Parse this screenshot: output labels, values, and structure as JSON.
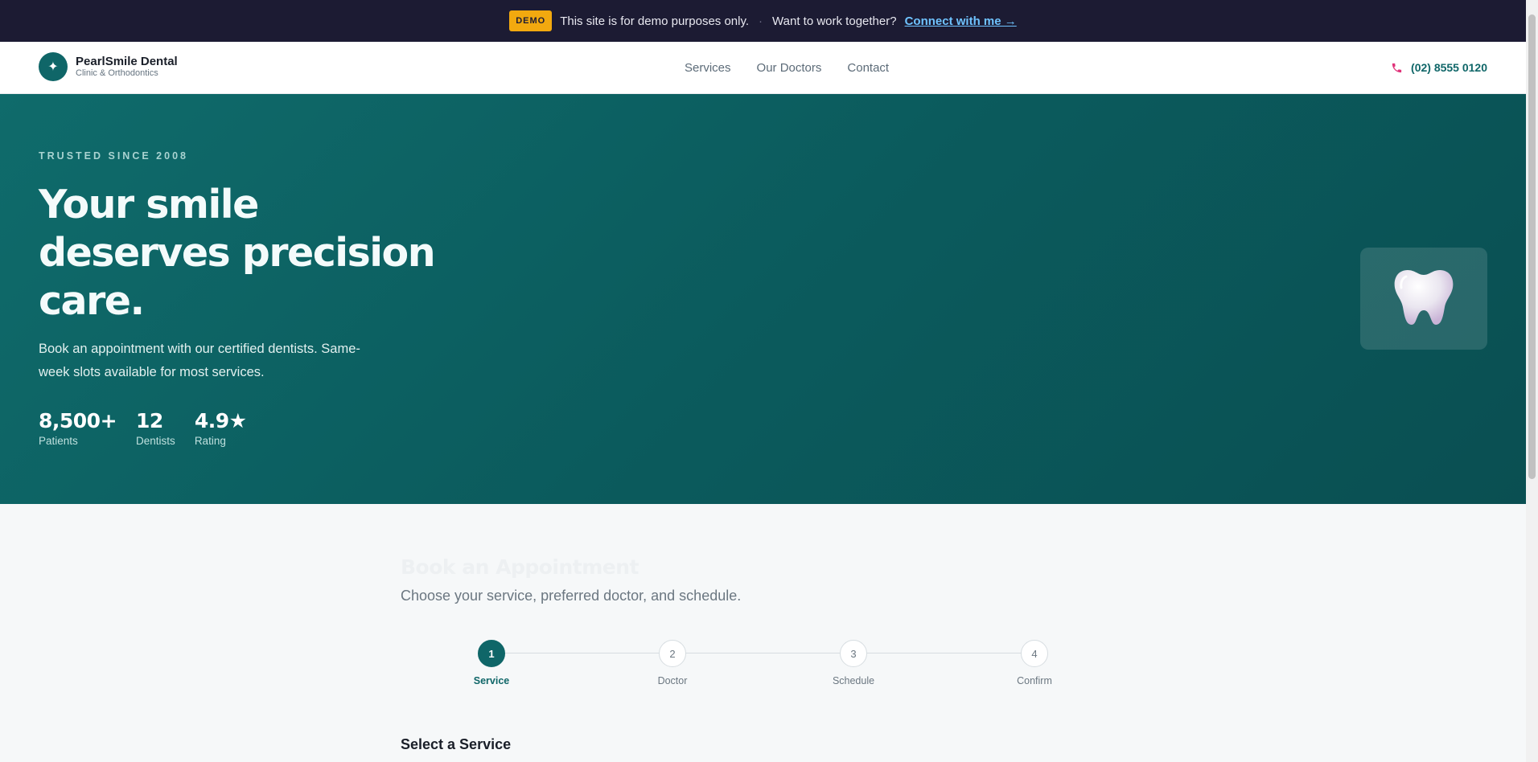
{
  "demo_bar": {
    "badge": "DEMO",
    "message": "This site is for demo purposes only.",
    "separator": "·",
    "question": "Want to work together?",
    "link": "Connect with me →"
  },
  "header": {
    "brand_name": "PearlSmile Dental",
    "brand_sub": "Clinic & Orthodontics",
    "logo_icon": "sparkle-icon",
    "nav": [
      "Services",
      "Our Doctors",
      "Contact"
    ],
    "phone": "(02) 8555 0120",
    "phone_icon": "phone-icon"
  },
  "hero": {
    "eyebrow": "TRUSTED SINCE 2008",
    "title": "Your smile deserves precision care.",
    "subtitle": "Book an appointment with our certified dentists. Same-week slots available for most services.",
    "stats": [
      {
        "value": "8,500+",
        "label": "Patients"
      },
      {
        "value": "12",
        "label": "Dentists"
      },
      {
        "value": "4.9★",
        "label": "Rating"
      }
    ],
    "image_icon": "tooth-icon"
  },
  "booking": {
    "title": "Book an Appointment",
    "subtitle": "Choose your service, preferred doctor, and schedule.",
    "steps": [
      {
        "number": "1",
        "label": "Service",
        "active": true
      },
      {
        "number": "2",
        "label": "Doctor",
        "active": false
      },
      {
        "number": "3",
        "label": "Schedule",
        "active": false
      },
      {
        "number": "4",
        "label": "Confirm",
        "active": false
      }
    ],
    "section_title": "Select a Service"
  },
  "colors": {
    "primary": "#0f6668",
    "banner_bg": "#1c1b33",
    "badge": "#f2a90f",
    "link": "#6fc3ff",
    "phone_icon": "#e0337a"
  }
}
